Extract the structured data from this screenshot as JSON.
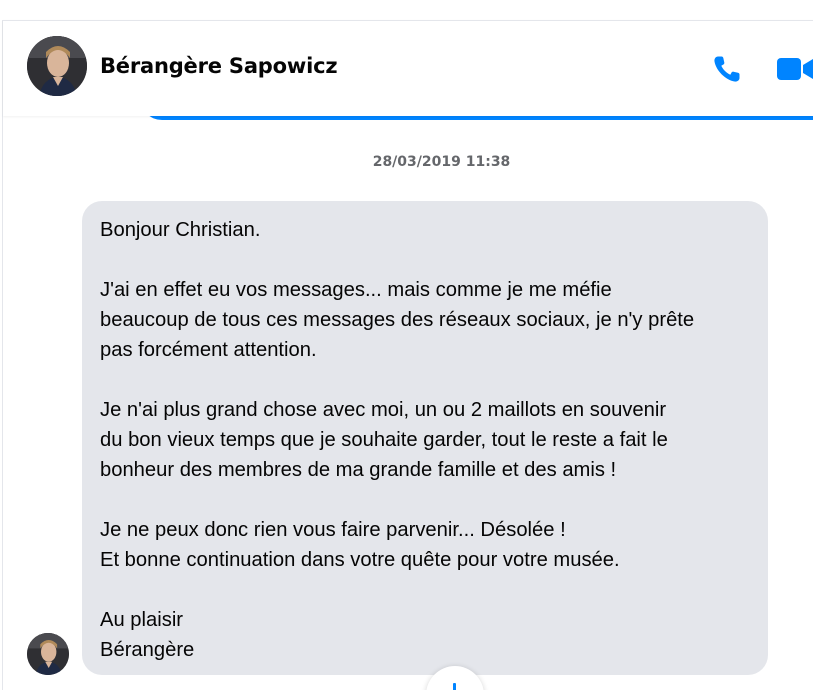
{
  "header": {
    "contact_name": "Bérangère Sapowicz",
    "call_icon": "phone-icon",
    "video_icon": "video-camera-icon"
  },
  "colors": {
    "accent": "#0084ff",
    "bubble_gray": "#e4e6eb",
    "timestamp_gray": "#65676b"
  },
  "conversation": {
    "timestamp": "28/03/2019 11:38",
    "message_lines": [
      "Bonjour Christian.",
      "",
      "J'ai en effet eu vos messages... mais comme je me méfie",
      "beaucoup de tous ces messages des réseaux sociaux, je n'y prête",
      "pas forcément attention.",
      "",
      "Je n'ai plus grand chose avec moi, un ou 2 maillots en souvenir",
      "du bon vieux temps que je souhaite garder, tout le reste a fait le",
      "bonheur des membres de ma grande famille et des amis !",
      "",
      "Je ne peux donc rien vous faire parvenir... Désolée !",
      "Et bonne continuation dans votre quête pour votre musée.",
      "",
      "Au plaisir",
      "Bérangère"
    ]
  }
}
